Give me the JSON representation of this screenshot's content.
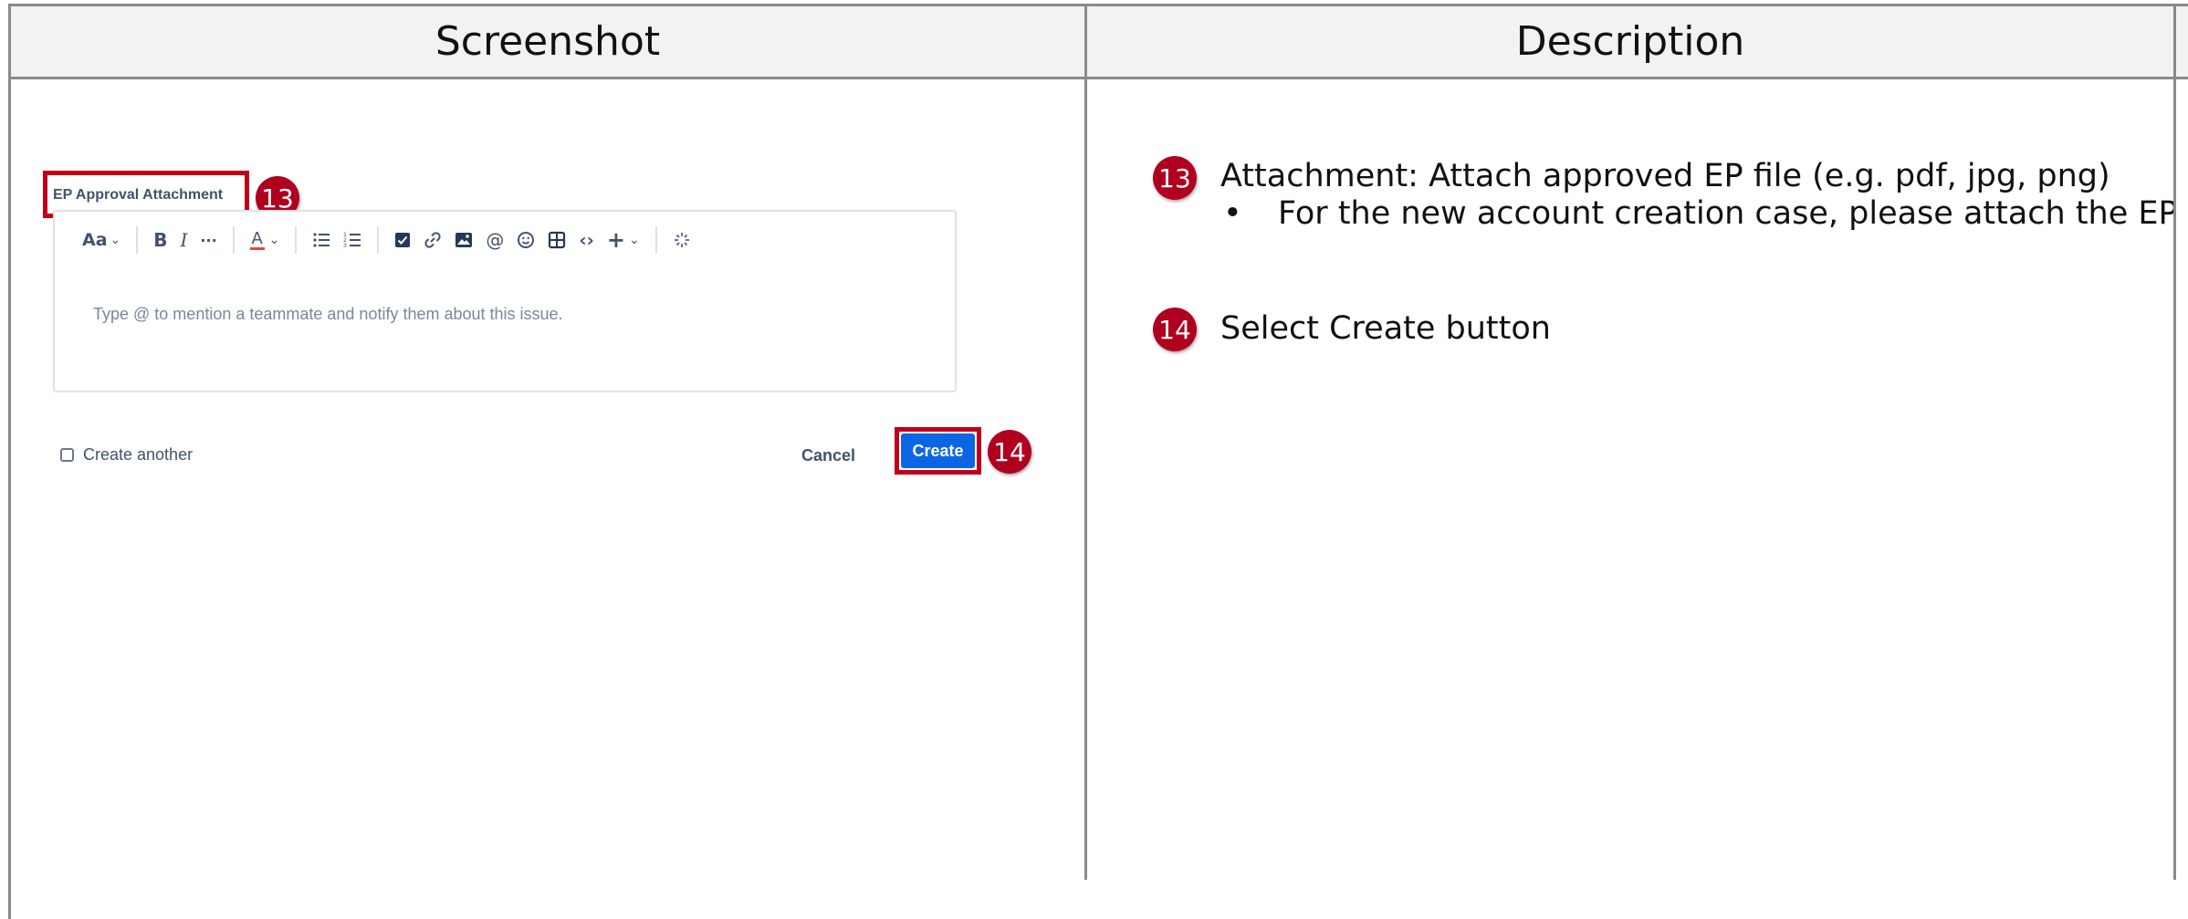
{
  "headers": {
    "screenshot": "Screenshot",
    "description": "Description"
  },
  "screenshot": {
    "field_label": "EP Approval Attachment",
    "badges": {
      "first": "13",
      "second": "14"
    },
    "toolbar": {
      "text_style": "Aa",
      "bold": "B",
      "italic": "I",
      "more": "···",
      "text_color": "A"
    },
    "editor_placeholder": "Type @ to mention a teammate and notify them about this issue.",
    "create_another_label": "Create another",
    "cancel_label": "Cancel",
    "create_label": "Create"
  },
  "description": {
    "items": [
      {
        "badge": "13",
        "text": "Attachment: Attach approved EP file (e.g. pdf, jpg, png)",
        "bullet": "For the new account creation case, please attach the EP approval"
      },
      {
        "badge": "14",
        "text": "Select Create button"
      }
    ],
    "bullet_symbol": "•"
  },
  "colors": {
    "highlight": "#c00018",
    "badge": "#b00020",
    "primary_button": "#0c66e4",
    "header_bg": "#f2f2f2"
  }
}
